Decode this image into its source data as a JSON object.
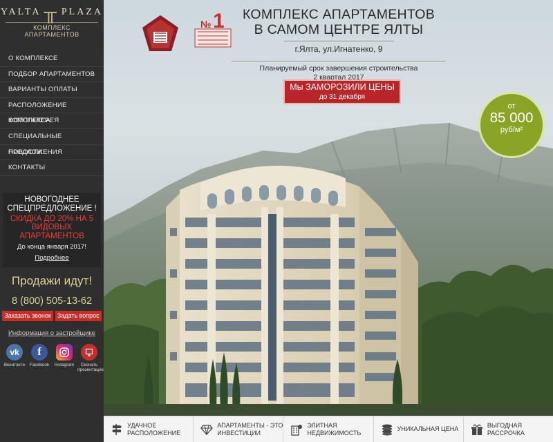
{
  "logo": {
    "brand_left": "YALTA",
    "brand_right": "PLAZA",
    "tagline": "КОМПЛЕКС АПАРТАМЕНТОВ"
  },
  "nav": [
    "О КОМПЛЕКСЕ",
    "ПОДБОР АПАРТАМЕНТОВ",
    "ВАРИАНТЫ ОПЛАТЫ",
    "РАСПОЛОЖЕНИЕ КОМПЛЕКСА",
    "ФОТОГАЛЕРЕЯ",
    "СПЕЦИАЛЬНЫЕ ПРЕДЛОЖЕНИЯ",
    "НОВОСТИ",
    "КОНТАКТЫ"
  ],
  "promo": {
    "title": "НОВОГОДНЕЕ СПЕЦПРЕДЛОЖЕНИЕ !",
    "highlight": "СКИДКА ДО 20% НА 5 ВИДОВЫХ АПАРТАМЕНТОВ",
    "deadline": "До конца января 2017!",
    "more_link": "Подробнее"
  },
  "sales_text": "Продажи идут!",
  "phone": "8 (800) 505-13-62",
  "buttons": {
    "callback": "Заказать звонок",
    "ask": "Задать вопрос"
  },
  "developer_link": "Информация о застройщике",
  "social": [
    {
      "label": "Вконтакте",
      "icon": "vk-icon",
      "color": "#4a76a8",
      "glyph": "vk"
    },
    {
      "label": "Facebook",
      "icon": "facebook-icon",
      "color": "#3b5998",
      "glyph": "f"
    },
    {
      "label": "Instagram",
      "icon": "instagram-icon",
      "color": "#c13584",
      "glyph": "◎"
    },
    {
      "label": "Скачать презентацию",
      "icon": "presentation-icon",
      "color": "#c3302c",
      "glyph": "▣"
    }
  ],
  "headline": {
    "line1": "КОМПЛЕКС АПАРТАМЕНТОВ",
    "line2": "В САМОМ ЦЕНТРЕ ЯЛТЫ",
    "address": "г.Ялта, ул.Игнатенко, 9",
    "plan_line1": "Планируемый срок завершения строительства",
    "plan_line2": "2 квартал 2017"
  },
  "freeze": {
    "line1": "Мы ЗАМОРОЗИЛИ ЦЕНЫ",
    "line2": "до 31 декабря"
  },
  "price": {
    "from": "от",
    "amount": "85 000",
    "unit": "руб/м²"
  },
  "awards": [
    {
      "icon": "award-badge-icon"
    },
    {
      "icon": "nominee-no1-icon"
    }
  ],
  "features": [
    {
      "icon": "signpost-icon",
      "label": "УДАЧНОЕ РАСПОЛОЖЕНИЕ"
    },
    {
      "icon": "diamond-icon",
      "label": "АПАРТАМЕНТЫ - ЭТО ИНВЕСТИЦИИ"
    },
    {
      "icon": "elite-building-icon",
      "label": "ЭЛИТНАЯ НЕДВИЖИМОСТЬ"
    },
    {
      "icon": "coins-icon",
      "label": "УНИКАЛЬНАЯ ЦЕНА"
    },
    {
      "icon": "gift-icon",
      "label": "ВЫГОДНАЯ РАССРОЧКА"
    }
  ],
  "colors": {
    "sidebar": "#2f2f2f",
    "accent_red": "#c3302c",
    "price_green": "#8aa526",
    "gold_text": "#d8cf9b"
  }
}
